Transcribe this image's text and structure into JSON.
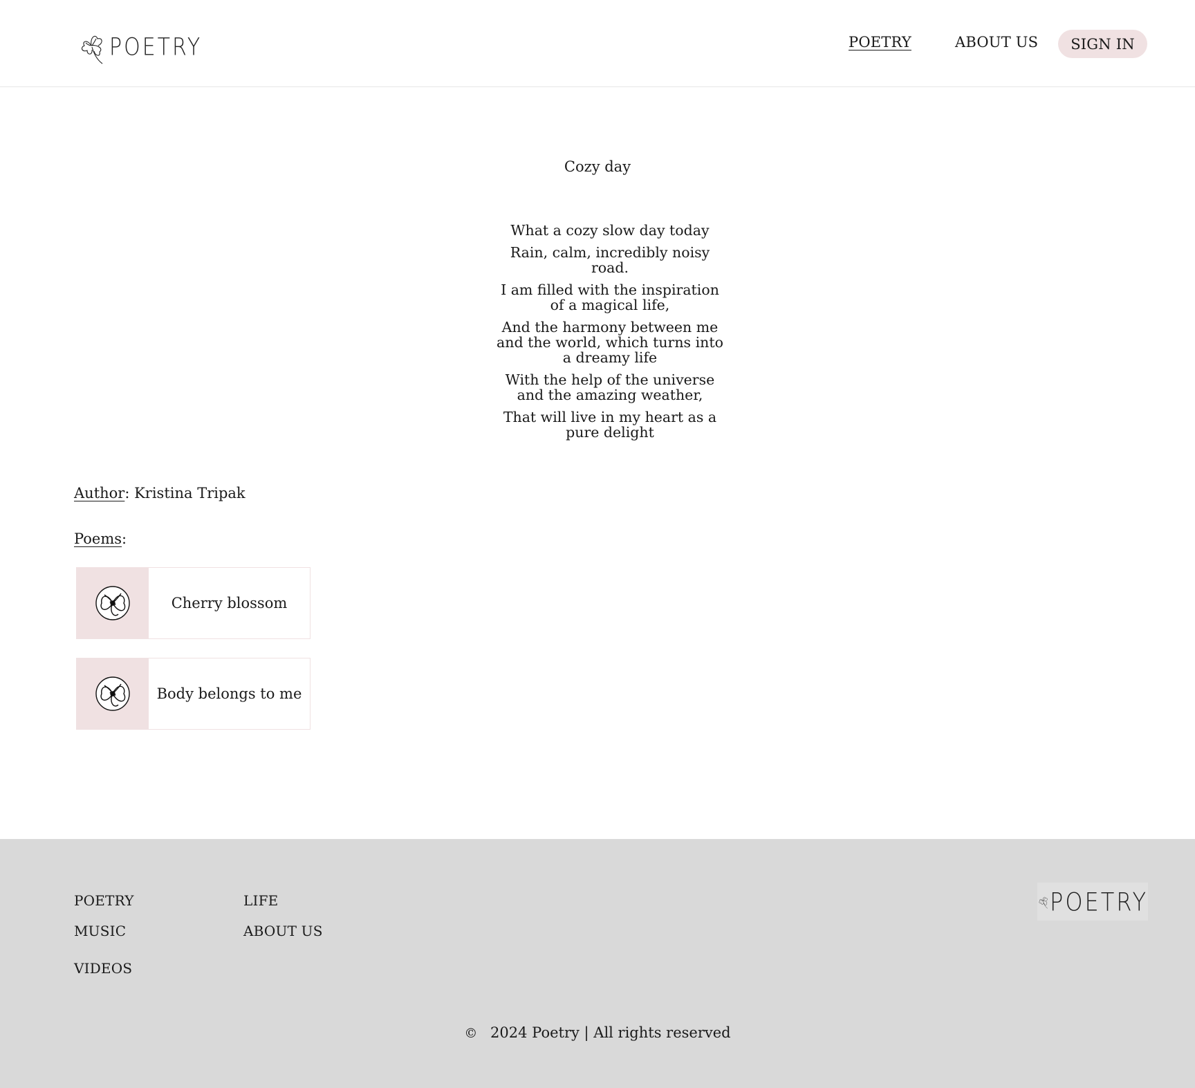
{
  "header": {
    "logo_text": "POETRY",
    "nav": {
      "poetry": "POETRY",
      "about": "ABOUT US"
    },
    "sign_in": "SIGN IN"
  },
  "poem": {
    "title": "Cozy day",
    "lines": [
      "What a cozy slow day today",
      "Rain, calm, incredibly noisy road.",
      "I am filled with the inspiration of a magical life,",
      "And the harmony between me and the world, which turns into a dreamy life",
      "With the help of the universe and the amazing weather,",
      "That will live in my heart as a pure delight"
    ]
  },
  "author": {
    "label": "Author",
    "separator": ":",
    "name": "Kristina Tripak"
  },
  "poems": {
    "label": "Poems",
    "separator": ":",
    "items": [
      {
        "title": "Cherry blossom",
        "icon": "flower-icon"
      },
      {
        "title": "Body belongs to me",
        "icon": "flower-icon"
      }
    ]
  },
  "footer": {
    "links_col1": [
      "POETRY",
      "MUSIC",
      "VIDEOS"
    ],
    "links_col2": [
      "LIFE",
      "ABOUT US"
    ],
    "logo_text": "POETRY",
    "copyright_symbol": "©",
    "copyright": "2024 Poetry | All rights reserved"
  },
  "colors": {
    "accent_pink": "#f0e1e2",
    "footer_bg": "#d9d9d9",
    "text": "#1a1a1a"
  }
}
